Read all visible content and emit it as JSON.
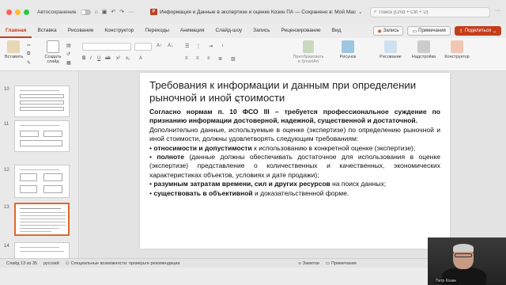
{
  "titlebar": {
    "autosave_label": "Автосохранение",
    "doc_title": "Информация и Данные в экспертизе и оценке Козин ПА — Сохранено в: Мой Mac",
    "search_placeholder": "Поиск (Cmd + Ctrl + U)"
  },
  "tabs": [
    "Главная",
    "Вставка",
    "Рисование",
    "Конструктор",
    "Переходы",
    "Анимация",
    "Слайд-шоу",
    "Запись",
    "Рецензирование",
    "Вид"
  ],
  "active_tab": "Главная",
  "tab_buttons": {
    "record": "Запись",
    "comments": "Примечания",
    "share": "Поделиться"
  },
  "ribbon": {
    "paste": "Вставить",
    "new_slide": "Создать\nслайд",
    "smartart": "Преобразовать\nв SmartArt",
    "picture": "Рисунок",
    "drawing": "Рисование",
    "addins": "Надстройки",
    "designer": "Конструктор"
  },
  "thumbnails": {
    "numbers": [
      "10",
      "11",
      "12",
      "13",
      "14"
    ],
    "selected": "13"
  },
  "slide": {
    "title": "Требования к информации и данным при определении рыночной и иной стоимости",
    "para1": "Согласно нормам п. 10 ФСО III – требуется профессиональное суждение по признанию информации достоверной, надежной, существенной и достаточной.",
    "para2": "Дополнительно данные, используемые в оценке (экспертизе) по определению рыночной и иной стоимости, должны удовлетворять следующим требованиям:",
    "b1_bold": "относимости и допустимости",
    "b1_rest": " к использованию в конкретной оценке (экспертизе);",
    "b2_bold": "полноте",
    "b2_rest": " (данные должны обеспечивать достаточное для использования в оценке (экспертизе) представление о количественных и качественных, экономических характеристиках объектов, условиях и дате продажи);",
    "b3_bold": "разумным затратам времени, сил и других ресурсов",
    "b3_rest": " на поиск данных;",
    "b4_bold": "существовать в объективной",
    "b4_rest": " и доказательственной форме."
  },
  "status": {
    "slide_info": "Слайд 13 из 35",
    "language": "русский",
    "accessibility": "Специальные возможности: проверьте рекомендации",
    "notes": "Заметки",
    "comments": "Примечания"
  },
  "webcam": {
    "name": "Петр Козин"
  },
  "colors": {
    "accent": "#c43e1c",
    "selected_thumb": "#e0672e"
  }
}
